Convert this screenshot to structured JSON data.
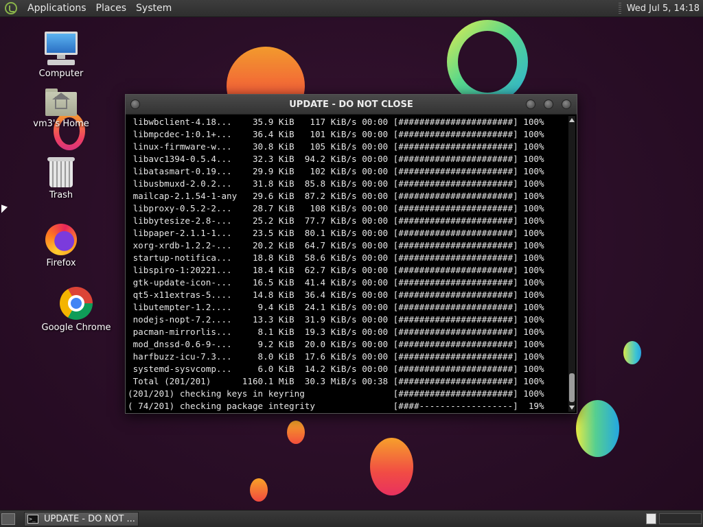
{
  "top_panel": {
    "menus": [
      "Applications",
      "Places",
      "System"
    ],
    "clock": "Wed Jul 5, 14:18"
  },
  "desktop": {
    "icons": [
      {
        "label": "Computer",
        "icon": "computer-icon"
      },
      {
        "label": "vm3's Home",
        "icon": "home-folder-icon"
      },
      {
        "label": "Trash",
        "icon": "trash-icon"
      },
      {
        "label": "Firefox",
        "icon": "firefox-icon"
      },
      {
        "label": "Google Chrome",
        "icon": "chrome-icon"
      }
    ]
  },
  "window": {
    "title": "UPDATE - DO NOT CLOSE",
    "lines": [
      " libwbclient-4.18...    35.9 KiB   117 KiB/s 00:00 [######################] 100%",
      " libmpcdec-1:0.1+...    36.4 KiB   101 KiB/s 00:00 [######################] 100%",
      " linux-firmware-w...    30.8 KiB   105 KiB/s 00:00 [######################] 100%",
      " libavc1394-0.5.4...    32.3 KiB  94.2 KiB/s 00:00 [######################] 100%",
      " libatasmart-0.19...    29.9 KiB   102 KiB/s 00:00 [######################] 100%",
      " libusbmuxd-2.0.2...    31.8 KiB  85.8 KiB/s 00:00 [######################] 100%",
      " mailcap-2.1.54-1-any   29.6 KiB  87.2 KiB/s 00:00 [######################] 100%",
      " libproxy-0.5.2-2...    28.7 KiB   108 KiB/s 00:00 [######################] 100%",
      " libbytesize-2.8-...    25.2 KiB  77.7 KiB/s 00:00 [######################] 100%",
      " libpaper-2.1.1-1...    23.5 KiB  80.1 KiB/s 00:00 [######################] 100%",
      " xorg-xrdb-1.2.2-...    20.2 KiB  64.7 KiB/s 00:00 [######################] 100%",
      " startup-notifica...    18.8 KiB  58.6 KiB/s 00:00 [######################] 100%",
      " libspiro-1:20221...    18.4 KiB  62.7 KiB/s 00:00 [######################] 100%",
      " gtk-update-icon-...    16.5 KiB  41.4 KiB/s 00:00 [######################] 100%",
      " qt5-x11extras-5....    14.8 KiB  36.4 KiB/s 00:00 [######################] 100%",
      " libutempter-1.2....     9.4 KiB  24.1 KiB/s 00:00 [######################] 100%",
      " nodejs-nopt-7.2....    13.3 KiB  31.9 KiB/s 00:00 [######################] 100%",
      " pacman-mirrorlis...     8.1 KiB  19.3 KiB/s 00:00 [######################] 100%",
      " mod_dnssd-0.6-9-...     9.2 KiB  20.0 KiB/s 00:00 [######################] 100%",
      " harfbuzz-icu-7.3...     8.0 KiB  17.6 KiB/s 00:00 [######################] 100%",
      " systemd-sysvcomp...     6.0 KiB  14.2 KiB/s 00:00 [######################] 100%",
      " Total (201/201)      1160.1 MiB  30.3 MiB/s 00:38 [######################] 100%",
      "(201/201) checking keys in keyring                 [######################] 100%",
      "( 74/201) checking package integrity               [####------------------]  19%"
    ]
  },
  "taskbar": {
    "task_label": "UPDATE - DO NOT ...",
    "task_icon_text": ">_"
  }
}
